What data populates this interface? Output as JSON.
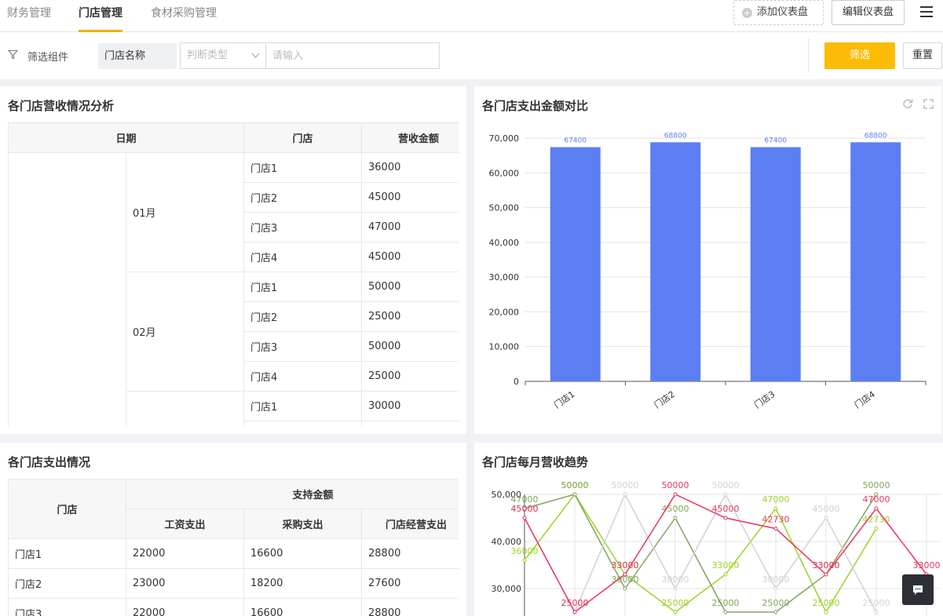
{
  "tabs": [
    {
      "label": "财务管理",
      "active": false
    },
    {
      "label": "门店管理",
      "active": true
    },
    {
      "label": "食材采购管理",
      "active": false
    }
  ],
  "toolbar": {
    "add_label": "添加仪表盘",
    "edit_label": "编辑仪表盘"
  },
  "filter": {
    "label": "筛选组件",
    "field": "门店名称",
    "select_placeholder": "判断类型",
    "input_placeholder": "请输入",
    "filter_button": "筛选",
    "reset_button": "重置"
  },
  "revenue_table": {
    "title": "各门店营收情况分析",
    "headers": [
      "日期",
      "门店",
      "营收金额"
    ],
    "groups": [
      {
        "month": "01月",
        "rows": [
          [
            "门店1",
            "36000"
          ],
          [
            "门店2",
            "45000"
          ],
          [
            "门店3",
            "47000"
          ],
          [
            "门店4",
            "45000"
          ]
        ]
      },
      {
        "month": "02月",
        "rows": [
          [
            "门店1",
            "50000"
          ],
          [
            "门店2",
            "25000"
          ],
          [
            "门店3",
            "50000"
          ],
          [
            "门店4",
            "25000"
          ]
        ]
      },
      {
        "month": "",
        "rows": [
          [
            "门店1",
            "30000"
          ],
          [
            "",
            ""
          ]
        ]
      }
    ]
  },
  "expense_table": {
    "title": "各门店支出情况",
    "store_header": "门店",
    "group_header": "支持金额",
    "sub_headers": [
      "工资支出",
      "采购支出",
      "门店经营支出"
    ],
    "rows": [
      [
        "门店1",
        "22000",
        "16600",
        "28800"
      ],
      [
        "门店2",
        "23000",
        "18200",
        "27600"
      ],
      [
        "门店3",
        "22000",
        "16600",
        "28800"
      ]
    ]
  },
  "colors": {
    "accent": "#fcbc05",
    "bar": "#5b7ff2"
  },
  "chart_data": [
    {
      "type": "bar",
      "title": "各门店支出金额对比",
      "categories": [
        "门店1",
        "门店2",
        "门店3",
        "门店4"
      ],
      "values": [
        67400,
        68800,
        67400,
        68800
      ],
      "ylim": [
        0,
        70000
      ],
      "yticks": [
        "70,000",
        "60,000",
        "50,000",
        "40,000",
        "30,000",
        "20,000",
        "10,000",
        "0"
      ],
      "grid": true
    },
    {
      "type": "line",
      "title": "各门店每月营收趋势",
      "ylim": [
        20000,
        50000
      ],
      "yticks": [
        "50,000",
        "40,000",
        "30,000"
      ],
      "grid": true,
      "series": [
        {
          "color": "#9ad428",
          "values": [
            36000,
            50000,
            33000,
            25000,
            33000,
            47000,
            25000,
            42730
          ]
        },
        {
          "color": "#82a35e",
          "values": [
            47000,
            50000,
            30000,
            45000,
            25000,
            25000,
            33000,
            50000
          ]
        },
        {
          "color": "#d2d2d2",
          "values": [
            45000,
            25000,
            50000,
            30000,
            50000,
            30000,
            45000,
            25000
          ]
        },
        {
          "color": "#e8355e",
          "values": [
            45000,
            25000,
            33000,
            50000,
            45000,
            42730,
            33000,
            47000,
            33000
          ]
        }
      ],
      "labels_visible": [
        {
          "series": 0,
          "text": "36000"
        },
        {
          "series": 0,
          "text": "33000"
        },
        {
          "series": 0,
          "text": "47000"
        },
        {
          "series": 0,
          "text": "4273"
        },
        {
          "series": 1,
          "text": "47000"
        },
        {
          "series": 1,
          "text": "50000"
        },
        {
          "series": 1,
          "text": "30000"
        },
        {
          "series": 1,
          "text": "45000"
        },
        {
          "series": 1,
          "text": "25000"
        },
        {
          "series": 1,
          "text": "25000"
        },
        {
          "series": 1,
          "text": "33000"
        },
        {
          "series": 1,
          "text": "50000"
        },
        {
          "series": 2,
          "text": "50000"
        },
        {
          "series": 2,
          "text": "30000"
        },
        {
          "series": 2,
          "text": "50000"
        },
        {
          "series": 2,
          "text": "45000"
        },
        {
          "series": 2,
          "text": "25000"
        },
        {
          "series": 3,
          "text": "45000"
        },
        {
          "series": 3,
          "text": "25000"
        },
        {
          "series": 3,
          "text": "33000"
        },
        {
          "series": 3,
          "text": "50000"
        },
        {
          "series": 3,
          "text": "45000"
        },
        {
          "series": 3,
          "text": "42730"
        },
        {
          "series": 3,
          "text": "47000"
        },
        {
          "series": 3,
          "text": "3000"
        }
      ]
    }
  ]
}
